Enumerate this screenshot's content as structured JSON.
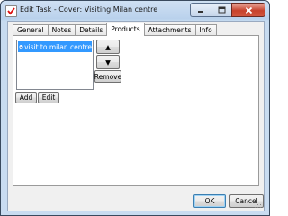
{
  "window": {
    "title": "Edit Task - Cover: Visiting Milan centre"
  },
  "tabs": [
    {
      "label": "General"
    },
    {
      "label": "Notes"
    },
    {
      "label": "Details"
    },
    {
      "label": "Products"
    },
    {
      "label": "Attachments"
    },
    {
      "label": "Info"
    }
  ],
  "products": {
    "items": [
      {
        "label": "visit to milan centre"
      }
    ],
    "move_up_symbol": "▲",
    "move_down_symbol": "▼",
    "remove_label": "Remove",
    "add_label": "Add",
    "edit_label": "Edit"
  },
  "footer": {
    "ok_label": "OK",
    "cancel_label": "Cancel"
  },
  "colors": {
    "selection": "#3399ff",
    "close_button": "#c7422c"
  },
  "icons": {
    "app": "task-check-icon",
    "item": "product-icon"
  }
}
